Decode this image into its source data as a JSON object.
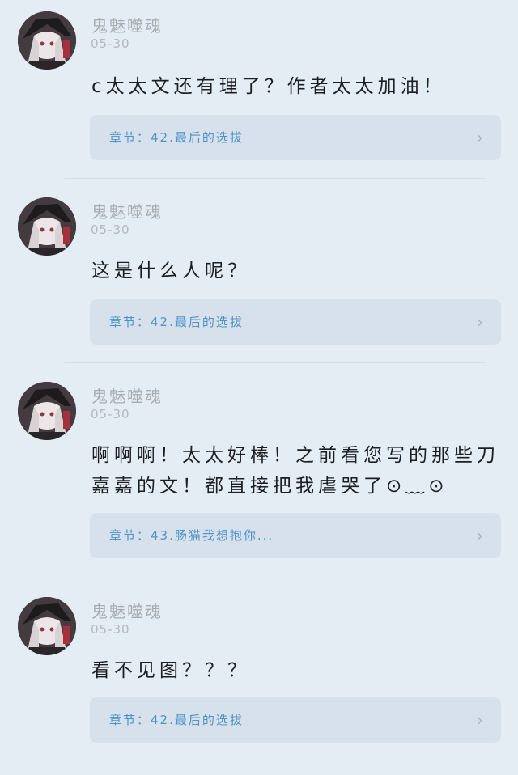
{
  "comments": [
    {
      "username": "鬼魅噬魂",
      "date": "05-30",
      "text": "c太太文还有理了？作者太太加油！",
      "chapter": "章节：42.最后的选拔"
    },
    {
      "username": "鬼魅噬魂",
      "date": "05-30",
      "text": "这是什么人呢？",
      "chapter": "章节：42.最后的选拔"
    },
    {
      "username": "鬼魅噬魂",
      "date": "05-30",
      "text": "啊啊啊！太太好棒！之前看您写的那些刀嘉嘉的文！都直接把我虐哭了⊙﹏⊙",
      "chapter": "章节：43.肠猫我想抱你..."
    },
    {
      "username": "鬼魅噬魂",
      "date": "05-30",
      "text": "看不见图？？？",
      "chapter": "章节：42.最后的选拔"
    }
  ],
  "icons": {
    "avatar": "avatar-icon",
    "chevron": "chevron-right-icon"
  }
}
